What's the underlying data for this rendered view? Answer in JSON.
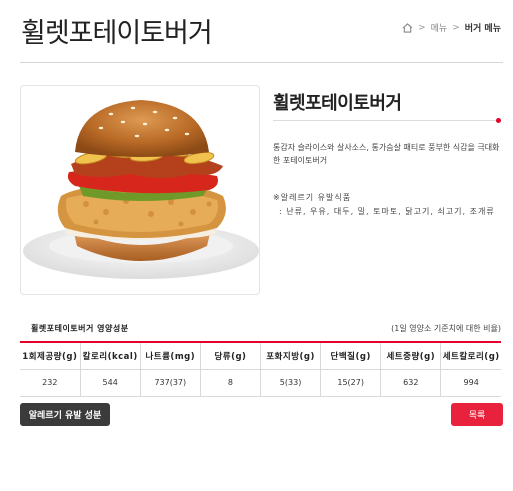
{
  "page": {
    "title": "휠렛포테이토버거"
  },
  "breadcrumb": {
    "home_icon": "home-icon",
    "menu": "메뉴",
    "current": "버거 메뉴",
    "separator": ">"
  },
  "product": {
    "name": "휠렛포테이토버거",
    "description": "통감자 슬라이스와 살사소스, 통가슴살 패티로 풍부한 식감을 극대화한 포테이토버거",
    "allergen_label": "※알레르기 유발식품",
    "allergen_list": ": 난류, 우유, 대두, 밀, 토마토, 닭고기, 쇠고기, 조개류",
    "image_icon": "burger-image"
  },
  "nutrition": {
    "title": "휠렛포테이토버거 영양성분",
    "note": "(1일 영양소 기준치에 대한 비율)",
    "headers": [
      "1회제공량(g)",
      "칼로리(kcal)",
      "나트륨(mg)",
      "당류(g)",
      "포화지방(g)",
      "단백질(g)",
      "세트중량(g)",
      "세트칼로리(g)"
    ],
    "values": [
      "232",
      "544",
      "737(37)",
      "8",
      "5(33)",
      "15(27)",
      "632",
      "994"
    ]
  },
  "buttons": {
    "allergen": "알레르기 유발 성분",
    "list": "목록"
  },
  "colors": {
    "accent": "#e4002b",
    "dark_button": "#3b3b3b",
    "list_button": "#e8223c"
  }
}
